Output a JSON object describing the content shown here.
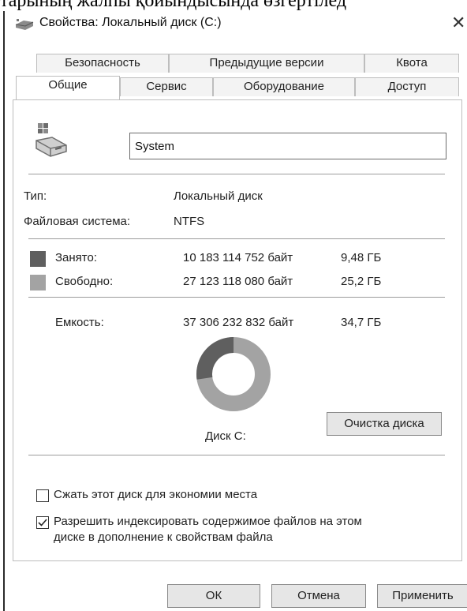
{
  "crop_text": "тарының жалпы қойындысында өзгертілед",
  "window": {
    "title": "Свойства: Локальный диск (C:)"
  },
  "tabs_row1": [
    {
      "label": "Безопасность"
    },
    {
      "label": "Предыдущие версии"
    },
    {
      "label": "Квота"
    }
  ],
  "tabs_row2": [
    {
      "label": "Общие",
      "active": true
    },
    {
      "label": "Сервис"
    },
    {
      "label": "Оборудование"
    },
    {
      "label": "Доступ"
    }
  ],
  "general": {
    "drive_name": "System",
    "type_label": "Тип:",
    "type_value": "Локальный диск",
    "fs_label": "Файловая система:",
    "fs_value": "NTFS",
    "used": {
      "label": "Занято:",
      "bytes": "10 183 114 752 байт",
      "size": "9,48 ГБ",
      "color": "#5f5f5f"
    },
    "free": {
      "label": "Свободно:",
      "bytes": "27 123 118 080 байт",
      "size": "25,2 ГБ",
      "color": "#a3a3a3"
    },
    "capacity": {
      "label": "Емкость:",
      "bytes": "37 306 232 832 байт",
      "size": "34,7 ГБ"
    },
    "disk_label": "Диск C:",
    "cleanup_button": "Очистка диска",
    "used_fraction": 0.273,
    "compress_label": "Сжать этот диск для экономии места",
    "compress_checked": false,
    "index_label_line1": "Разрешить индексировать содержимое файлов на этом",
    "index_label_line2": "диске в дополнение к свойствам файла",
    "index_checked": true
  },
  "buttons": {
    "ok": "ОК",
    "cancel": "Отмена",
    "apply": "Применить"
  }
}
